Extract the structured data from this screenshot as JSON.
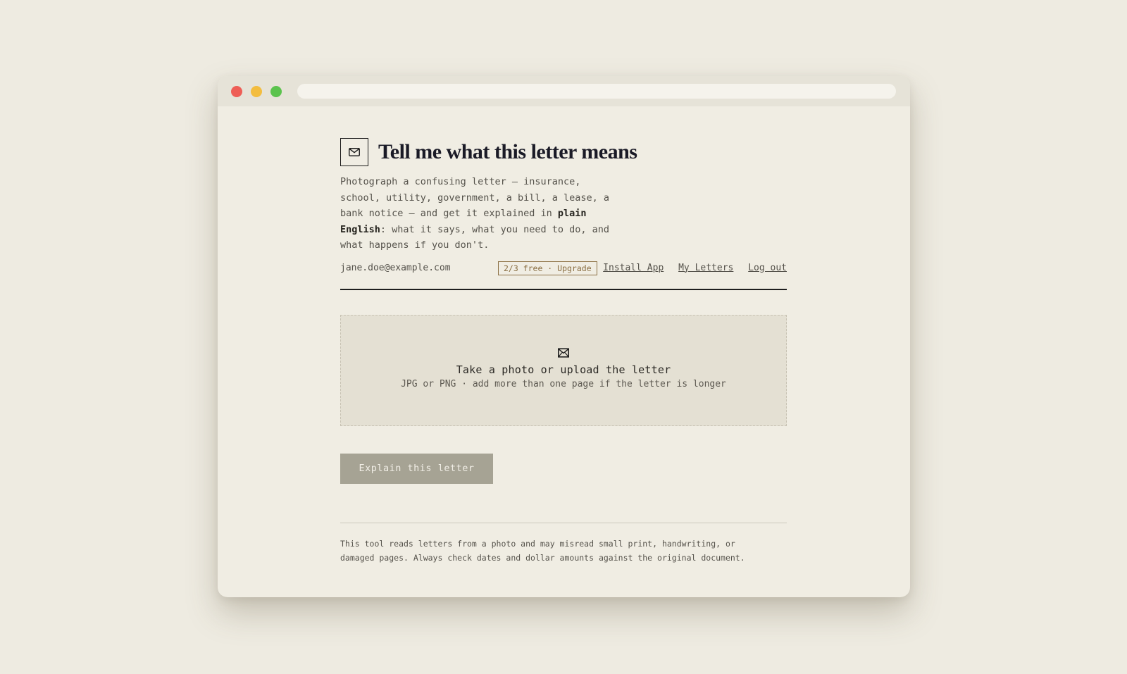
{
  "app": {
    "title": "Tell me what this letter means",
    "logo_icon": "envelope-icon",
    "intro": {
      "part1": "Photograph a confusing letter — insurance, school, utility, government, a bill, a lease, a bank notice — and get it explained in ",
      "emphasis": "plain English",
      "part2": ": what it says, what you need to do, and what happens if you don't."
    }
  },
  "user": {
    "email": "jane.doe@example.com",
    "quota_badge": "2/3 free · Upgrade"
  },
  "nav": {
    "install_app": "Install App",
    "my_letters": "My Letters",
    "log_out": "Log out"
  },
  "upload": {
    "icon": "envelope-icon",
    "title": "Take a photo or upload the letter",
    "subtitle": "JPG or PNG · add more than one page if the letter is longer"
  },
  "actions": {
    "explain_button": "Explain this letter",
    "explain_enabled": false
  },
  "footer": {
    "disclaimer_line1": "This tool reads letters from a photo and may misread small print, handwriting, or",
    "disclaimer_line2": "damaged pages. Always check dates and dollar amounts against the original document."
  },
  "colors": {
    "page_background": "#eeebe1",
    "window_background": "#f0ede3",
    "dropzone_background": "#e4e0d3",
    "badge_accent": "#8a6e42",
    "button_disabled": "#a6a394",
    "title_text": "#1a1a26"
  }
}
